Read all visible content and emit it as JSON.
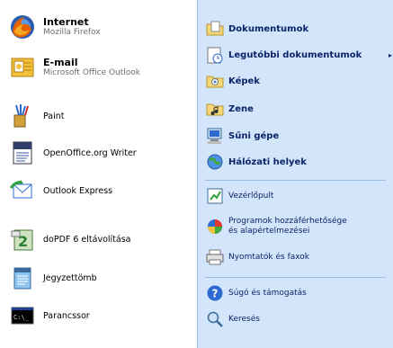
{
  "left": {
    "pinned": [
      {
        "title": "Internet",
        "subtitle": "Mozilla Firefox",
        "icon": "firefox-icon"
      },
      {
        "title": "E-mail",
        "subtitle": "Microsoft Office Outlook",
        "icon": "outlook-icon"
      }
    ],
    "recent": [
      {
        "label": "Paint",
        "icon": "paint-icon"
      },
      {
        "label": "OpenOffice.org Writer",
        "icon": "openoffice-writer-icon"
      },
      {
        "label": "Outlook Express",
        "icon": "outlook-express-icon"
      },
      {
        "label": "doPDF 6 eltávolítása",
        "icon": "dopdf-uninstall-icon"
      },
      {
        "label": "Jegyzettömb",
        "icon": "notepad-icon"
      },
      {
        "label": "Parancssor",
        "icon": "command-prompt-icon"
      }
    ]
  },
  "right": {
    "places": [
      {
        "label": "Dokumentumok",
        "icon": "documents-folder-icon"
      },
      {
        "label": "Legutóbbi dokumentumok",
        "icon": "recent-documents-icon",
        "arrow": "▸"
      },
      {
        "label": "Képek",
        "icon": "pictures-folder-icon"
      },
      {
        "label": "Zene",
        "icon": "music-folder-icon"
      },
      {
        "label": "Sűni gépe",
        "icon": "my-computer-icon"
      },
      {
        "label": "Hálózati helyek",
        "icon": "network-places-icon"
      }
    ],
    "system": [
      {
        "label": "Vezérlőpult",
        "icon": "control-panel-icon"
      },
      {
        "label_line1": "Programok hozzáférhetősége",
        "label_line2": "és alapértelmezései",
        "icon": "program-defaults-icon"
      },
      {
        "label": "Nyomtatók és faxok",
        "icon": "printers-faxes-icon"
      }
    ],
    "help": [
      {
        "label": "Súgó és támogatás",
        "icon": "help-icon"
      },
      {
        "label": "Keresés",
        "icon": "search-icon"
      }
    ]
  }
}
